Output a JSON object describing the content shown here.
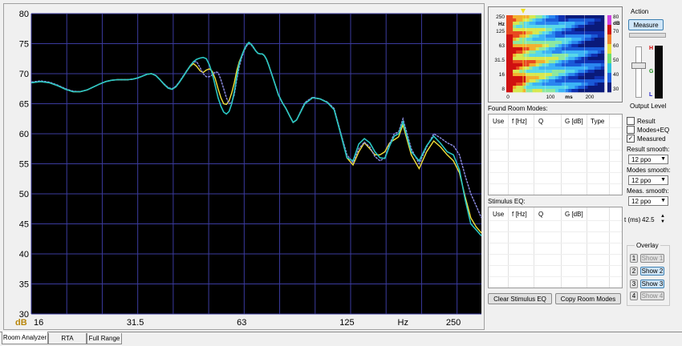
{
  "chart_data": {
    "type": "line",
    "x_scale": "log",
    "xlim": [
      16,
      300
    ],
    "ylim": [
      30,
      80
    ],
    "y_ticks": [
      30,
      35,
      40,
      45,
      50,
      55,
      60,
      65,
      70,
      75,
      80
    ],
    "x_tick_labels": [
      {
        "x": 16,
        "label": "16"
      },
      {
        "x": 31.5,
        "label": "31.5"
      },
      {
        "x": 63,
        "label": "63"
      },
      {
        "x": 125,
        "label": "125"
      },
      {
        "x": 180,
        "label": "Hz"
      },
      {
        "x": 250,
        "label": "250"
      }
    ],
    "y_unit_label": "dB",
    "grid": true,
    "colors": {
      "background": "#000000",
      "grid": "#3b3b9e",
      "measured": "#29c7c4",
      "overlay2": "#8f8fe6",
      "overlay3": "#f4e23a"
    },
    "series": [
      {
        "key": "measured",
        "color": "#29c7c4",
        "x": [
          16,
          17,
          18,
          19,
          20,
          21,
          22,
          23,
          24,
          25,
          26,
          27,
          28,
          29,
          30,
          31,
          32,
          33,
          34,
          35,
          36,
          37,
          38,
          39,
          40,
          41,
          42,
          43,
          44,
          45,
          46,
          47,
          48,
          49,
          50,
          51,
          52,
          53,
          54,
          55,
          56,
          57,
          58,
          59,
          60,
          61,
          62,
          63,
          64,
          65,
          66,
          67,
          68,
          69,
          70,
          71,
          72,
          73,
          74,
          75,
          76,
          78,
          80,
          82,
          84,
          86,
          88,
          90,
          95,
          100,
          105,
          110,
          115,
          120,
          125,
          130,
          135,
          140,
          145,
          150,
          155,
          160,
          165,
          170,
          175,
          180,
          190,
          200,
          210,
          220,
          230,
          240,
          250,
          260,
          270,
          280,
          290,
          300
        ],
        "y": [
          68.5,
          68.7,
          68.5,
          68.0,
          67.4,
          67.0,
          67.0,
          67.3,
          67.8,
          68.3,
          68.7,
          68.9,
          69.0,
          69.0,
          69.0,
          69.1,
          69.3,
          69.6,
          69.9,
          70.0,
          69.7,
          69.0,
          68.2,
          67.6,
          67.4,
          67.8,
          68.6,
          69.5,
          70.4,
          71.3,
          72.0,
          72.4,
          72.6,
          72.7,
          72.5,
          71.5,
          70.0,
          68.0,
          66.0,
          64.6,
          63.6,
          63.3,
          63.7,
          65.0,
          67.0,
          69.5,
          71.7,
          73.0,
          74.0,
          74.8,
          75.2,
          74.9,
          74.4,
          73.8,
          73.4,
          73.3,
          73.3,
          73.0,
          72.4,
          71.5,
          70.5,
          68.5,
          66.5,
          65.2,
          64.2,
          63.0,
          61.9,
          62.3,
          65.0,
          66.0,
          65.8,
          65.2,
          64.0,
          60.0,
          56.0,
          55.5,
          58.3,
          59.2,
          58.5,
          57.0,
          56.0,
          55.9,
          58.0,
          59.6,
          60.0,
          62.0,
          57.0,
          55.5,
          58.0,
          59.6,
          58.4,
          57.0,
          56.5,
          54.0,
          49.0,
          45.0,
          44.0,
          43.0
        ]
      },
      {
        "key": "overlay2",
        "color": "#8f8fe6",
        "x": [
          16,
          17,
          18,
          19,
          20,
          21,
          22,
          23,
          24,
          25,
          26,
          27,
          28,
          29,
          30,
          31,
          32,
          33,
          34,
          35,
          36,
          37,
          38,
          39,
          40,
          41,
          42,
          43,
          44,
          45,
          46,
          47,
          48,
          49,
          50,
          51,
          52,
          53,
          54,
          55,
          56,
          57,
          58,
          59,
          60,
          61,
          62,
          63,
          64,
          65,
          66,
          67,
          68,
          69,
          70,
          71,
          72,
          73,
          74,
          75,
          76,
          78,
          80,
          82,
          84,
          86,
          88,
          90,
          95,
          100,
          105,
          110,
          115,
          120,
          125,
          130,
          135,
          140,
          145,
          150,
          155,
          160,
          165,
          170,
          175,
          180,
          190,
          200,
          210,
          220,
          230,
          240,
          250,
          260,
          270,
          280,
          290,
          300
        ],
        "y": [
          68.6,
          68.8,
          68.6,
          68.1,
          67.5,
          67.1,
          67.0,
          67.3,
          67.8,
          68.3,
          68.7,
          68.9,
          69.0,
          69.0,
          69.0,
          69.1,
          69.3,
          69.6,
          69.9,
          70.0,
          69.7,
          69.0,
          68.3,
          67.7,
          67.5,
          67.9,
          68.7,
          69.6,
          70.5,
          71.3,
          71.9,
          72.0,
          71.0,
          70.0,
          69.5,
          69.5,
          69.8,
          70.3,
          70.2,
          69.0,
          67.5,
          66.0,
          65.0,
          65.2,
          66.5,
          69.0,
          71.2,
          72.7,
          73.8,
          74.6,
          75.0,
          74.8,
          74.3,
          73.8,
          73.4,
          73.3,
          73.3,
          73.0,
          72.4,
          71.5,
          70.5,
          68.5,
          66.5,
          65.2,
          64.2,
          63.0,
          61.9,
          62.3,
          65.2,
          66.1,
          65.8,
          65.3,
          64.2,
          60.2,
          56.5,
          55.2,
          57.5,
          58.6,
          57.8,
          56.2,
          55.5,
          56.0,
          58.3,
          60.0,
          60.3,
          62.5,
          57.5,
          55.0,
          57.8,
          60.0,
          59.3,
          58.5,
          58.0,
          56.5,
          53.0,
          50.0,
          48.0,
          46.0
        ]
      },
      {
        "key": "overlay3",
        "color": "#f4e23a",
        "x": [
          16,
          17,
          18,
          19,
          20,
          21,
          22,
          23,
          24,
          25,
          26,
          27,
          28,
          29,
          30,
          31,
          32,
          33,
          34,
          35,
          36,
          37,
          38,
          39,
          40,
          41,
          42,
          43,
          44,
          45,
          46,
          47,
          48,
          49,
          50,
          51,
          52,
          53,
          54,
          55,
          56,
          57,
          58,
          59,
          60,
          61,
          62,
          63,
          64,
          65,
          66,
          67,
          68,
          69,
          70,
          71,
          72,
          73,
          74,
          75,
          76,
          78,
          80,
          82,
          84,
          86,
          88,
          90,
          95,
          100,
          105,
          110,
          115,
          120,
          125,
          130,
          135,
          140,
          145,
          150,
          155,
          160,
          165,
          170,
          175,
          180,
          190,
          200,
          210,
          220,
          230,
          240,
          250,
          260,
          270,
          280,
          290,
          300
        ],
        "y": [
          68.5,
          68.7,
          68.5,
          68.0,
          67.4,
          67.0,
          67.0,
          67.3,
          67.8,
          68.3,
          68.7,
          68.9,
          69.0,
          69.0,
          69.0,
          69.1,
          69.3,
          69.6,
          69.9,
          70.0,
          69.7,
          69.0,
          68.2,
          67.6,
          67.4,
          67.8,
          68.6,
          69.5,
          70.4,
          71.2,
          71.7,
          71.2,
          70.5,
          70.2,
          70.6,
          70.8,
          70.4,
          69.2,
          67.5,
          66.0,
          65.0,
          64.9,
          65.5,
          66.8,
          68.5,
          70.5,
          72.0,
          73.0,
          74.0,
          74.8,
          75.2,
          74.9,
          74.4,
          73.8,
          73.4,
          73.3,
          73.3,
          73.0,
          72.4,
          71.5,
          70.5,
          68.5,
          66.5,
          65.2,
          64.2,
          63.0,
          61.9,
          62.3,
          65.0,
          66.0,
          65.8,
          65.2,
          64.0,
          60.0,
          56.0,
          54.8,
          57.0,
          58.5,
          57.5,
          56.5,
          56.5,
          57.0,
          58.5,
          59.0,
          59.5,
          61.5,
          56.5,
          54.2,
          57.0,
          58.8,
          57.8,
          56.5,
          55.5,
          53.5,
          49.5,
          46.0,
          44.5,
          43.5
        ]
      }
    ]
  },
  "heatmap": {
    "y_ticks": [
      "250",
      "125",
      "63",
      "31.5",
      "16",
      "8"
    ],
    "y_unit": "Hz",
    "x_ticks": [
      "0",
      "100",
      "ms",
      "200"
    ],
    "scale_ticks": [
      "80",
      "70",
      "60",
      "50",
      "40",
      "30"
    ],
    "scale_unit": "dB"
  },
  "action": {
    "title": "Action",
    "measure_label": "Measure",
    "output_level_label": "Output Level",
    "level_marks": {
      "high": "H",
      "good": "G",
      "low": "L"
    }
  },
  "room_modes": {
    "title": "Found Room Modes:",
    "columns": [
      "Use",
      "f [Hz]",
      "Q",
      "G [dB]",
      "Type"
    ]
  },
  "stimulus_eq": {
    "title": "Stimulus EQ:",
    "columns": [
      "Use",
      "f [Hz]",
      "Q",
      "G [dB]"
    ]
  },
  "checkboxes": [
    {
      "label": "Result",
      "checked": false
    },
    {
      "label": "Modes+EQ",
      "checked": false
    },
    {
      "label": "Measured",
      "checked": true
    }
  ],
  "smoothing": {
    "result_label": "Result smooth:",
    "result_value": "12 ppo",
    "modes_label": "Modes smooth:",
    "modes_value": "12 ppo",
    "meas_label": "Meas. smooth:",
    "meas_value": "12 ppo"
  },
  "time": {
    "label": "t (ms)",
    "value": "42.5"
  },
  "overlay": {
    "title": "Overlay",
    "items": [
      {
        "num": "1",
        "label": "Show 1",
        "active": false
      },
      {
        "num": "2",
        "label": "Show 2",
        "active": true
      },
      {
        "num": "3",
        "label": "Show 3",
        "active": true
      },
      {
        "num": "4",
        "label": "Show 4",
        "active": false
      }
    ]
  },
  "buttons": {
    "clear_eq": "Clear Stimulus EQ",
    "copy_modes": "Copy Room Modes"
  },
  "tabs": [
    "Room Analyzer",
    "RTA",
    "Full Range"
  ]
}
